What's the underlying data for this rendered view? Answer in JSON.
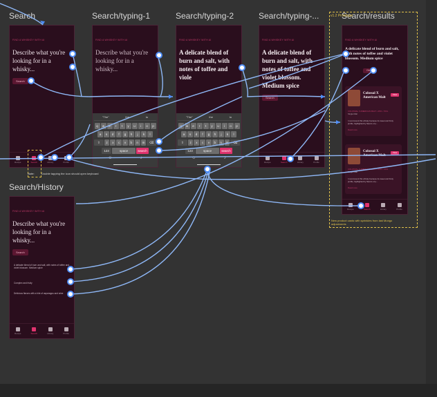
{
  "frames": {
    "search": "Search",
    "typing1": "Search/typing-1",
    "typing2": "Search/typing-2",
    "typing3": "Search/typing-...",
    "results": "Search/results",
    "history": "Search/History"
  },
  "results_tag": "v1.2 Prototype",
  "screens": {
    "eyebrow": "FIND A WHISKEY WITH AI",
    "prompt_default": "Describe what you're looking for in a whisky...",
    "prompt_typing1": "Describe what you're looking for in a whisky...",
    "prompt_typing2": "A delicate blend of burn and salt, with notes of toffee and viole",
    "prompt_typing3": "A delicate blend of burn and salt, with notes of toffee and violet blossom. Medium spice",
    "prompt_results": "A delicate blend of burn and salt, with notes of toffee and violet blossom. Medium spice",
    "search_button": "Search",
    "clear_button": "Clear",
    "history_button": "Search"
  },
  "tabs": [
    "Recipe",
    "Search",
    "Library",
    "Profile"
  ],
  "keyboard": {
    "suggestions": [
      "\"The\"",
      "the",
      "to"
    ],
    "row1": [
      "q",
      "w",
      "e",
      "r",
      "t",
      "y",
      "u",
      "i",
      "o",
      "p"
    ],
    "row2": [
      "a",
      "s",
      "d",
      "f",
      "g",
      "h",
      "j",
      "k",
      "l"
    ],
    "row3": [
      "z",
      "x",
      "c",
      "v",
      "b",
      "n",
      "m"
    ],
    "numbers": "123",
    "space": "space",
    "go": "search"
  },
  "results": {
    "cards": [
      {
        "name": "Colossal X American Malt",
        "meta": "COLOSSAL X AMERICAN MALT • 46% • 70CL",
        "sub": "Single Malt",
        "button": "View",
        "desc": "I recommend this whisky because its sweet and fruity profile, highlighted by flavors of p...",
        "more": "Read more"
      },
      {
        "name": "Colossal X American Malt",
        "meta": "COLOSSAL X AMERICAN MALT • 46% • 70CL",
        "sub": "Single Malt",
        "button": "View",
        "desc": "I recommend this whisky because its sweet and fruity profile, highlighted by flavors of p...",
        "more": "Read more"
      }
    ],
    "note": "New product cards with sprinkles from last Mongo adjustments"
  },
  "history": {
    "items": [
      "A delicate blend of burn and salt, with notes of toffee and violet blossom. Medium spice",
      "Complex and fruity",
      "Delicious flavors with a hint of asparagus and wine"
    ]
  },
  "search_note": {
    "label": "Note:",
    "text": "Double tapping the icon should open keyboard"
  },
  "colors": {
    "canvas": "#333333",
    "phone_bg": "#2a0e1d",
    "accent": "#e0336e",
    "link": "#4f8df5",
    "note_yellow": "#e2c24a"
  }
}
